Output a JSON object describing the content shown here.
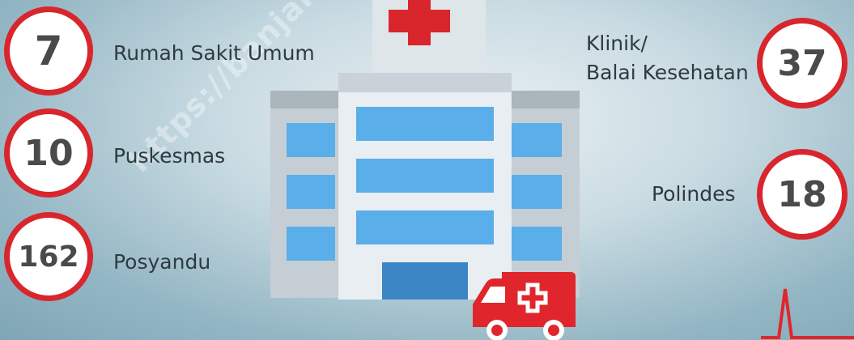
{
  "stats": {
    "rumah_sakit": {
      "value": "7",
      "label": "Rumah Sakit Umum"
    },
    "puskesmas": {
      "value": "10",
      "label": "Puskesmas"
    },
    "posyandu": {
      "value": "162",
      "label": "Posyandu"
    },
    "klinik": {
      "value": "37",
      "label_line1": "Klinik/",
      "label_line2": "Balai Kesehatan"
    },
    "polindes": {
      "value": "18",
      "label": "Polindes"
    }
  },
  "watermark": "https://banjarbarukota.bps.go.id",
  "colors": {
    "accent_red": "#d8262c",
    "window_blue": "#5aaeea",
    "building_light": "#e8eef2",
    "building_gray": "#b8c3ca"
  },
  "icons": [
    "hospital-building-icon",
    "medical-cross-icon",
    "ambulance-icon",
    "heartbeat-line-icon"
  ]
}
